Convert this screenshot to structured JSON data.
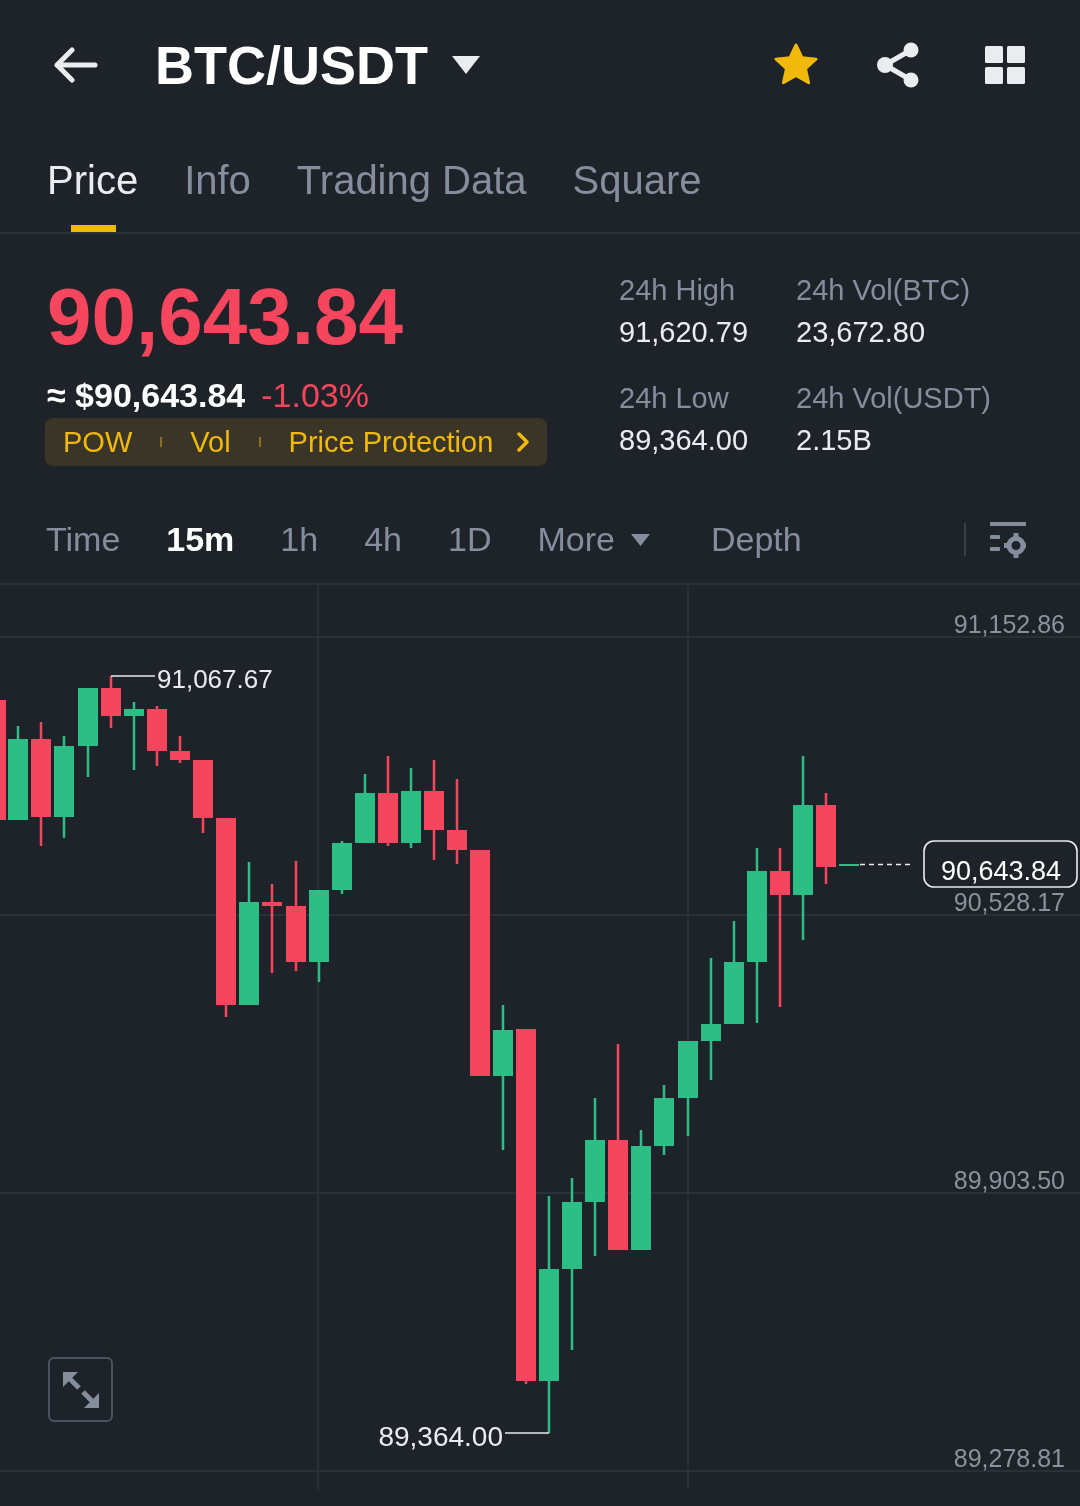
{
  "header": {
    "title": "BTC/USDT",
    "favorite": true
  },
  "tabs": [
    {
      "label": "Price",
      "selected": true
    },
    {
      "label": "Info",
      "selected": false
    },
    {
      "label": "Trading Data",
      "selected": false
    },
    {
      "label": "Square",
      "selected": false
    }
  ],
  "ticker": {
    "last_price": "90,643.84",
    "fiat_price": "≈ $90,643.84",
    "change": "-1.03%",
    "falling": true
  },
  "tags": [
    "POW",
    "Vol",
    "Price Protection"
  ],
  "stats": [
    {
      "label": "24h High",
      "value": "91,620.79"
    },
    {
      "label": "24h Vol(BTC)",
      "value": "23,672.80"
    },
    {
      "label": "24h Low",
      "value": "89,364.00"
    },
    {
      "label": "24h Vol(USDT)",
      "value": "2.15B"
    }
  ],
  "intervals": [
    {
      "label": "Time",
      "kind": "option",
      "selected": false
    },
    {
      "label": "15m",
      "kind": "option",
      "selected": true
    },
    {
      "label": "1h",
      "kind": "option",
      "selected": false
    },
    {
      "label": "4h",
      "kind": "option",
      "selected": false
    },
    {
      "label": "1D",
      "kind": "option",
      "selected": false
    },
    {
      "label": "More",
      "kind": "dropdown",
      "selected": false
    },
    {
      "label": "Depth",
      "kind": "option",
      "selected": false
    }
  ],
  "chart": {
    "price_axis": [
      "91,152.86",
      "90,528.17",
      "89,903.50",
      "89,278.81"
    ],
    "high_label": "91,067.67",
    "low_label": "89,364.00",
    "last_price_label": "90,643.84"
  }
}
